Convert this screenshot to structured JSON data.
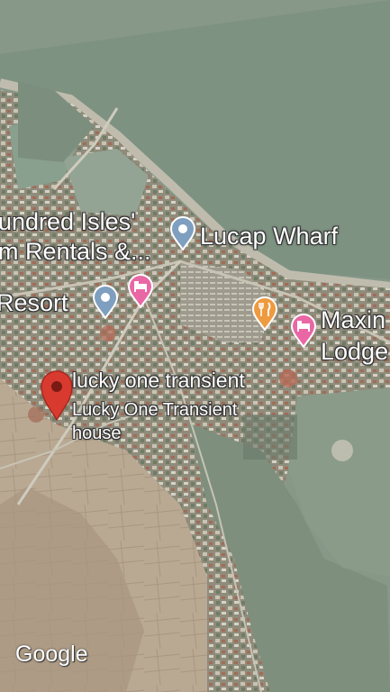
{
  "colors": {
    "water": "#8a9a8c",
    "shore": "#b7b4a6",
    "land": "#8c8a78",
    "field": "#b7a58f",
    "pin_red": "#d93a2f",
    "pin_blue": "#7e9fbf",
    "pin_pink": "#ea67a5",
    "pin_orange": "#ee9a3e"
  },
  "places": {
    "hundred_isles": {
      "line1": "undred Isles'",
      "line2": "m Rentals &...",
      "icon": "map-pin-icon"
    },
    "lucap_wharf": {
      "label": "Lucap Wharf",
      "icon": "map-pin-icon"
    },
    "resort": {
      "label": "Resort",
      "icon": "map-pin-icon"
    },
    "hotel_icon": {
      "icon": "bed-icon"
    },
    "restaurant": {
      "icon": "fork-knife-icon"
    },
    "maxine": {
      "line1": "Maxin",
      "line2": "Lodge",
      "icon": "bed-icon"
    },
    "lucky_one": {
      "title": "lucky one transient",
      "line1": "Lucky One Transient",
      "line2": "house",
      "icon": "red-pin-icon"
    }
  },
  "attribution": {
    "logo": "Google"
  }
}
